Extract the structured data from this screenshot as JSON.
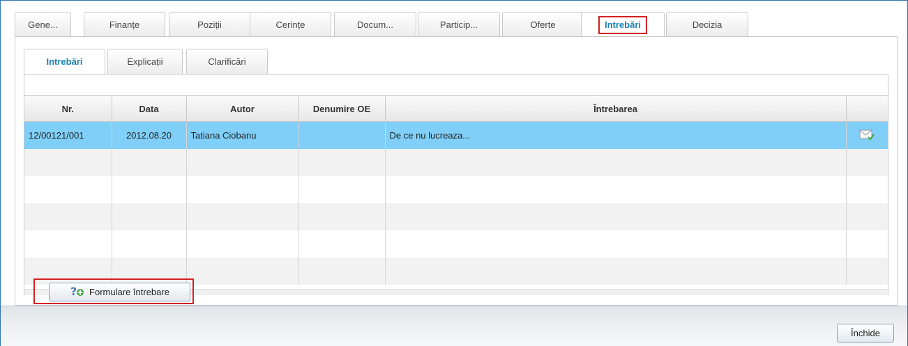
{
  "top_tabs": [
    {
      "label": "Gene..."
    },
    {
      "label": "Finanțe"
    },
    {
      "label": "Poziții"
    },
    {
      "label": "Cerințe"
    },
    {
      "label": "Docum..."
    },
    {
      "label": "Particip..."
    },
    {
      "label": "Oferte"
    },
    {
      "label": "Intrebări",
      "active": true
    },
    {
      "label": "Decizia"
    }
  ],
  "sub_tabs": [
    {
      "label": "Intrebări",
      "active": true
    },
    {
      "label": "Explicații"
    },
    {
      "label": "Clarificări"
    }
  ],
  "grid": {
    "columns": [
      "Nr.",
      "Data",
      "Autor",
      "Denumire OE",
      "Întrebarea",
      ""
    ],
    "rows": [
      {
        "nr": "12/00121/001",
        "data": "2012.08.20",
        "autor": "Tatiana Ciobanu",
        "denumire_oe": "",
        "intrebarea": "De ce nu lucreaza...",
        "icon": "mail-check-icon",
        "selected": true
      }
    ]
  },
  "buttons": {
    "formulare_label": "Formulare întrebare",
    "formulare_icon": "question-add-icon",
    "inchide_label": "Închide"
  },
  "colors": {
    "accent": "#1a7fb0",
    "selection": "#7fcff8",
    "highlight_border": "#d42020",
    "frame_border": "#2e74b5"
  }
}
